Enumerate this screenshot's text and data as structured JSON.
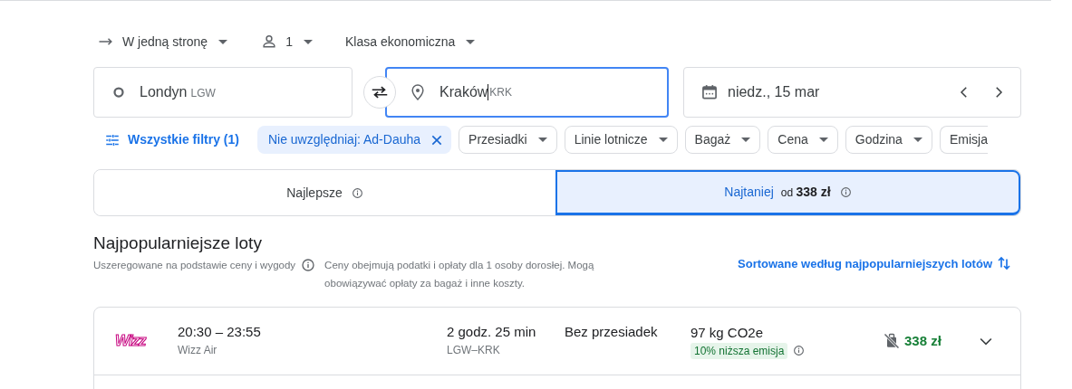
{
  "trip_options": [
    {
      "kind": "trip_type",
      "label": "W jedną stronę"
    },
    {
      "kind": "passengers",
      "label": "1"
    },
    {
      "kind": "cabin_class",
      "label": "Klasa ekonomiczna"
    }
  ],
  "search": {
    "origin": {
      "city": "Londyn",
      "code": "LGW"
    },
    "destination": {
      "city": "Kraków",
      "code": "KRK",
      "focused": true
    },
    "date": "niedz., 15 mar"
  },
  "filters": {
    "all_filters": "Wszystkie filtry (1)",
    "active_chip": "Nie uwzględniaj: Ad-Dauha",
    "dropdowns": [
      "Przesiadki",
      "Linie lotnicze",
      "Bagaż",
      "Cena",
      "Godzina",
      "Emisja"
    ]
  },
  "sort_tabs": [
    {
      "label": "Najlepsze",
      "selected": false
    },
    {
      "label": "Najtaniej",
      "price": "od **338 zł**",
      "selected": true
    }
  ],
  "section": {
    "title": "Najpopularniejsze loty",
    "ranking_note": "Uszeregowane na podstawie ceny i wygody",
    "price_note": "Ceny obejmują podatki i opłaty dla 1 osoby dorosłej. Mogą obowiązywać opłaty za bagaż i inne koszty.",
    "sort_link": "Sortowane według najpopularniejszych lotów"
  },
  "flights": [
    {
      "logo_text": "Wizz",
      "times": "20:30 – 23:55",
      "airline": "Wizz Air",
      "duration": "2 godz. 25 min",
      "route": "LGW–KRK",
      "stops": "Bez przesiadek",
      "emissions": "97 kg CO2e",
      "emissions_badge": "10% niższa emisja",
      "price": "338 zł"
    }
  ]
}
